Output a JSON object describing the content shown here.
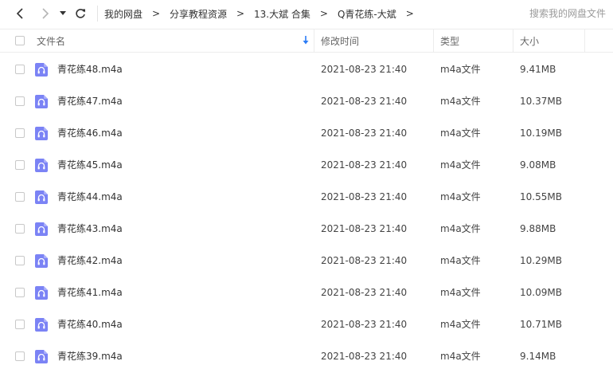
{
  "toolbar": {
    "breadcrumb": [
      {
        "label": "我的网盘"
      },
      {
        "label": "分享教程资源"
      },
      {
        "label": "13.大斌 合集"
      },
      {
        "label": "Q青花练-大斌"
      }
    ],
    "crumb_separator": ">",
    "search_placeholder": "搜索我的网盘文件"
  },
  "header": {
    "name": "文件名",
    "time": "修改时间",
    "type": "类型",
    "size": "大小"
  },
  "colors": {
    "icon_purple": "#7b83f5",
    "nav_icon": "#333333",
    "sort_arrow": "#2b7cf6"
  },
  "files": [
    {
      "name": "青花练48.m4a",
      "time": "2021-08-23 21:40",
      "type": "m4a文件",
      "size": "9.41MB"
    },
    {
      "name": "青花练47.m4a",
      "time": "2021-08-23 21:40",
      "type": "m4a文件",
      "size": "10.37MB"
    },
    {
      "name": "青花练46.m4a",
      "time": "2021-08-23 21:40",
      "type": "m4a文件",
      "size": "10.19MB"
    },
    {
      "name": "青花练45.m4a",
      "time": "2021-08-23 21:40",
      "type": "m4a文件",
      "size": "9.08MB"
    },
    {
      "name": "青花练44.m4a",
      "time": "2021-08-23 21:40",
      "type": "m4a文件",
      "size": "10.55MB"
    },
    {
      "name": "青花练43.m4a",
      "time": "2021-08-23 21:40",
      "type": "m4a文件",
      "size": "9.88MB"
    },
    {
      "name": "青花练42.m4a",
      "time": "2021-08-23 21:40",
      "type": "m4a文件",
      "size": "10.29MB"
    },
    {
      "name": "青花练41.m4a",
      "time": "2021-08-23 21:40",
      "type": "m4a文件",
      "size": "10.09MB"
    },
    {
      "name": "青花练40.m4a",
      "time": "2021-08-23 21:40",
      "type": "m4a文件",
      "size": "10.71MB"
    },
    {
      "name": "青花练39.m4a",
      "time": "2021-08-23 21:40",
      "type": "m4a文件",
      "size": "9.14MB"
    }
  ]
}
